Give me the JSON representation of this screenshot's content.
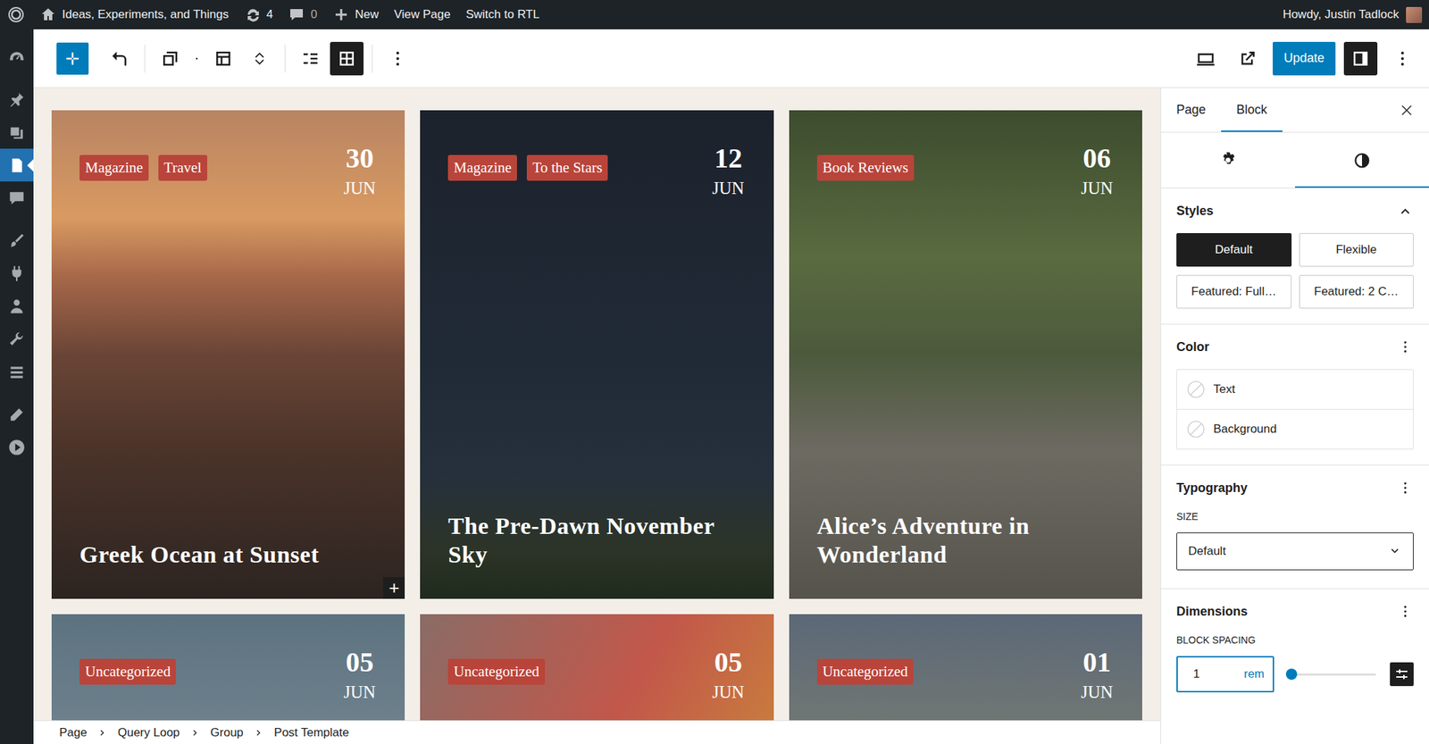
{
  "adminBar": {
    "siteName": "Ideas, Experiments, and Things",
    "updates": "4",
    "comments": "0",
    "newLabel": "New",
    "links": [
      "View Page",
      "Switch to RTL"
    ],
    "greeting": "Howdy, Justin Tadlock"
  },
  "adminMenu": [
    [
      {
        "kind": "dashboard",
        "selected": false
      }
    ],
    [
      {
        "kind": "posts",
        "selected": false
      },
      {
        "kind": "media",
        "selected": false
      },
      {
        "kind": "pages",
        "selected": true
      },
      {
        "kind": "comments",
        "selected": false
      }
    ],
    [
      {
        "kind": "appearance",
        "selected": false
      },
      {
        "kind": "plugins",
        "selected": false
      },
      {
        "kind": "users",
        "selected": false
      },
      {
        "kind": "tools",
        "selected": false
      },
      {
        "kind": "settings",
        "selected": false
      }
    ],
    [
      {
        "kind": "edit",
        "selected": false
      },
      {
        "kind": "media-player",
        "selected": false
      }
    ]
  ],
  "toolbar": {
    "left": [
      [
        {
          "kind": "inserter",
          "selected": false
        },
        {
          "kind": "parent",
          "selected": false
        }
      ],
      [
        {
          "kind": "block-type",
          "selected": false
        },
        {
          "kind": "drag",
          "selected": false
        },
        {
          "kind": "layout",
          "selected": false
        },
        {
          "kind": "mover",
          "selected": false
        }
      ],
      [
        {
          "kind": "justify",
          "selected": false
        },
        {
          "kind": "grid",
          "selected": true
        }
      ],
      [
        {
          "kind": "more",
          "selected": false
        }
      ]
    ],
    "right": [
      {
        "kind": "preview",
        "selected": false
      },
      {
        "kind": "external",
        "selected": false
      }
    ],
    "update": "Update",
    "afterUpdate": [
      {
        "kind": "sidebar",
        "selected": true
      },
      {
        "kind": "more",
        "selected": false
      }
    ]
  },
  "canvas": {
    "appender": "+",
    "posts": [
      {
        "tags": [
          "Magazine",
          "Travel"
        ],
        "day": "30",
        "month": "JUN",
        "title": "Greek Ocean at Sunset",
        "selected": true
      },
      {
        "tags": [
          "Magazine",
          "To the Stars"
        ],
        "day": "12",
        "month": "JUN",
        "title": "The Pre-Dawn November Sky",
        "selected": false
      },
      {
        "tags": [
          "Book Reviews"
        ],
        "day": "06",
        "month": "JUN",
        "title": "Alice’s Adventure in Wonderland",
        "selected": false
      },
      {
        "tags": [
          "Uncategorized"
        ],
        "day": "05",
        "month": "JUN",
        "selected": false
      },
      {
        "tags": [
          "Uncategorized"
        ],
        "day": "05",
        "month": "JUN",
        "selected": false
      },
      {
        "tags": [
          "Uncategorized"
        ],
        "day": "01",
        "month": "JUN",
        "selected": false
      }
    ]
  },
  "breadcrumb": [
    "Page",
    "Query Loop",
    "Group",
    "Post Template"
  ],
  "sidebar": {
    "tabs": [
      {
        "label": "Page",
        "selected": false
      },
      {
        "label": "Block",
        "selected": true
      }
    ],
    "panelTabs": [
      {
        "kind": "gear",
        "selected": false
      },
      {
        "kind": "styles",
        "selected": true
      }
    ],
    "styles": {
      "title": "Styles",
      "expanded": true,
      "options": [
        {
          "label": "Default",
          "selected": true
        },
        {
          "label": "Flexible",
          "selected": false
        },
        {
          "label": "Featured: Full…",
          "selected": false
        },
        {
          "label": "Featured: 2 C…",
          "selected": false
        }
      ]
    },
    "color": {
      "title": "Color",
      "items": [
        "Text",
        "Background"
      ]
    },
    "typography": {
      "title": "Typography",
      "sizeLabel": "SIZE",
      "size": "Default"
    },
    "dimensions": {
      "title": "Dimensions",
      "spacingLabel": "BLOCK SPACING",
      "value": "1",
      "unit": "rem",
      "level": 0.04
    }
  }
}
